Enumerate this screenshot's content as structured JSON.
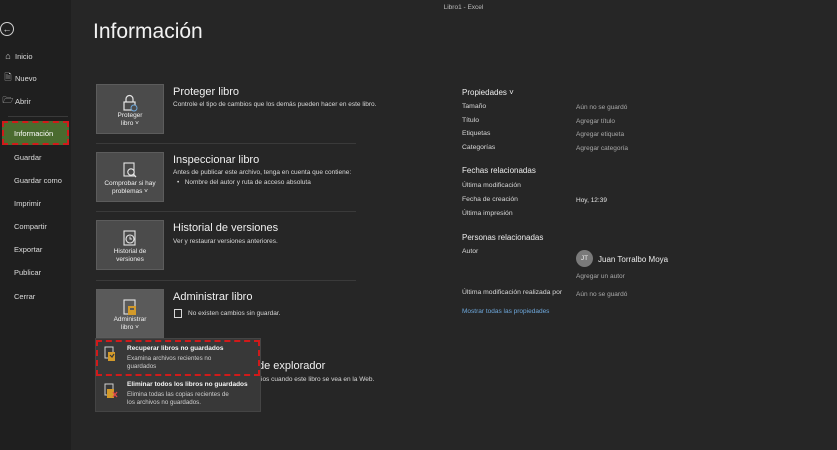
{
  "window": {
    "title": "Libro1  -  Excel"
  },
  "page": {
    "title": "Información"
  },
  "sidebar": {
    "items": [
      {
        "label": "Inicio",
        "icon": "home-icon"
      },
      {
        "label": "Nuevo",
        "icon": "new-document-icon"
      },
      {
        "label": "Abrir",
        "icon": "folder-open-icon"
      },
      {
        "label": "Información",
        "selected": true
      },
      {
        "label": "Guardar"
      },
      {
        "label": "Guardar como"
      },
      {
        "label": "Imprimir"
      },
      {
        "label": "Compartir"
      },
      {
        "label": "Exportar"
      },
      {
        "label": "Publicar"
      },
      {
        "label": "Cerrar"
      }
    ],
    "selected_color": "#4a6b2f"
  },
  "sections": {
    "protect": {
      "tile_line1": "Proteger",
      "tile_line2": "libro ˅",
      "title": "Proteger libro",
      "desc": "Controle el tipo de cambios que los demás pueden hacer en este libro."
    },
    "inspect": {
      "tile_line1": "Comprobar si hay",
      "tile_line2": "problemas ˅",
      "title": "Inspeccionar libro",
      "desc": "Antes de publicar este archivo, tenga en cuenta que contiene:",
      "bullet": "Nombre del autor y ruta de acceso absoluta"
    },
    "versions": {
      "tile_line1": "Historial de",
      "tile_line2": "versiones",
      "title": "Historial de versiones",
      "desc": "Ver y restaurar versiones anteriores."
    },
    "manage": {
      "tile_line1": "Administrar",
      "tile_line2": "libro ˅",
      "title": "Administrar libro",
      "desc": "No existen cambios sin guardar."
    },
    "browser": {
      "title_partial": "de explorador",
      "desc_partial": "ios cuando este libro se vea en la Web."
    }
  },
  "dropdown": {
    "items": [
      {
        "title": "Recuperar libros no guardados",
        "desc_line1": "Examina archivos recientes no",
        "desc_line2": "guardados"
      },
      {
        "title": "Eliminar todos los libros no guardados",
        "desc_line1": "Elimina todas las copias recientes de",
        "desc_line2": "los archivos no guardados."
      }
    ]
  },
  "properties": {
    "title": "Propiedades ˅",
    "rows": [
      {
        "label": "Tamaño",
        "value": "Aún no se guardó"
      },
      {
        "label": "Título",
        "value": "Agregar título"
      },
      {
        "label": "Etiquetas",
        "value": "Agregar etiqueta"
      },
      {
        "label": "Categorías",
        "value": "Agregar categoría"
      }
    ],
    "dates_title": "Fechas relacionadas",
    "dates": [
      {
        "label": "Última modificación",
        "value": ""
      },
      {
        "label": "Fecha de creación",
        "value": "Hoy, 12:39"
      },
      {
        "label": "Última impresión",
        "value": ""
      }
    ],
    "people_title": "Personas relacionadas",
    "author_label": "Autor",
    "author_initials": "JT",
    "author_name": "Juan Torralbo Moya",
    "add_author": "Agregar un autor",
    "last_modified_by_label": "Última modificación realizada por",
    "last_modified_by_value": "Aún no se guardó",
    "show_all": "Mostrar todas las propiedades"
  },
  "colors": {
    "background": "#262626",
    "sidebar": "#1f1f1f",
    "highlight_border": "#d11a1a",
    "link": "#6ea8dc"
  }
}
